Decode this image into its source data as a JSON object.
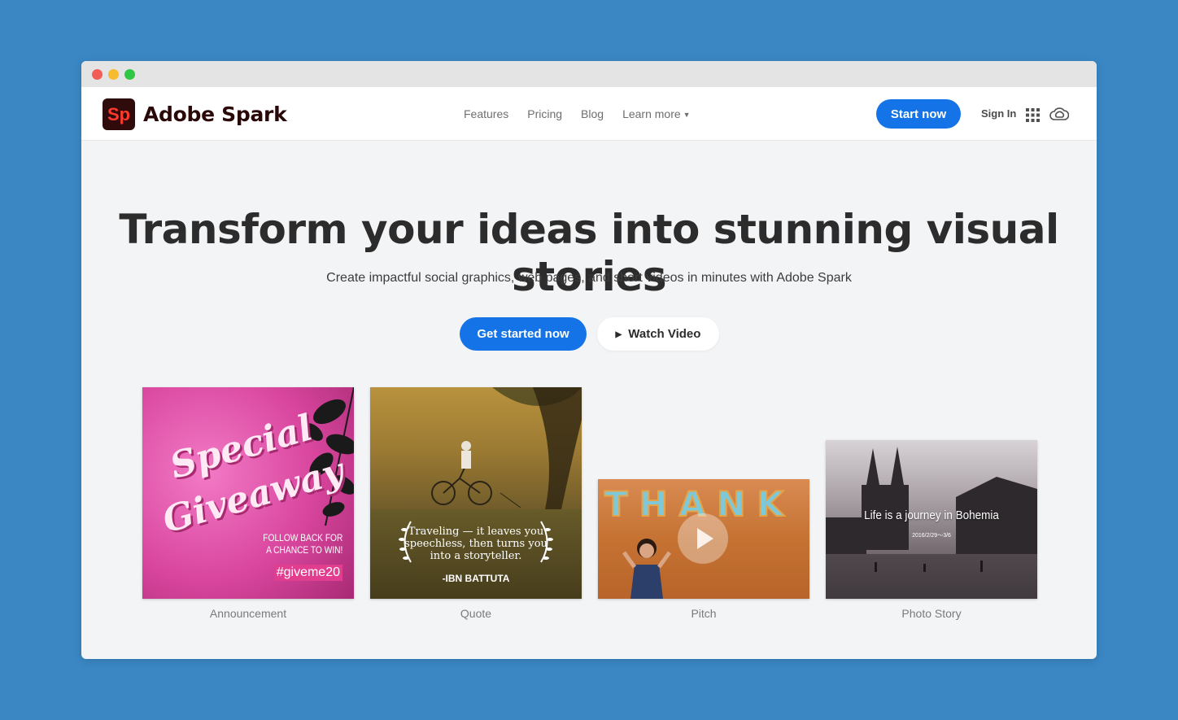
{
  "brand": {
    "logo_mark": "Sp",
    "name": "Adobe Spark"
  },
  "nav": {
    "links": [
      "Features",
      "Pricing",
      "Blog",
      "Learn more"
    ],
    "start_now": "Start now",
    "sign_in": "Sign In",
    "icons": [
      "apps-grid-icon",
      "creative-cloud-icon"
    ]
  },
  "hero": {
    "title": "Transform your ideas into stunning visual stories",
    "subtitle": "Create impactful social graphics, web pages, and short videos in minutes with Adobe Spark",
    "primary_cta": "Get started now",
    "secondary_cta": "Watch Video"
  },
  "cards": [
    {
      "label": "Announcement",
      "line1": "Special",
      "line2": "Giveaway",
      "follow": "FOLLOW BACK FOR",
      "follow2": "A CHANCE TO WIN!",
      "tag": "#giveme20"
    },
    {
      "label": "Quote",
      "quote": "Traveling — it leaves you speechless, then turns you into a storyteller.",
      "author": "-IBN BATTUTA"
    },
    {
      "label": "Pitch",
      "letters": "THANK"
    },
    {
      "label": "Photo Story",
      "title": "Life is a journey in Bohemia",
      "date": "2016/2/29〜3/6"
    }
  ],
  "colors": {
    "accent": "#1473e6",
    "background": "#3a87c4",
    "logo_bg": "#300b0b",
    "logo_fg": "#ff3a2d"
  }
}
